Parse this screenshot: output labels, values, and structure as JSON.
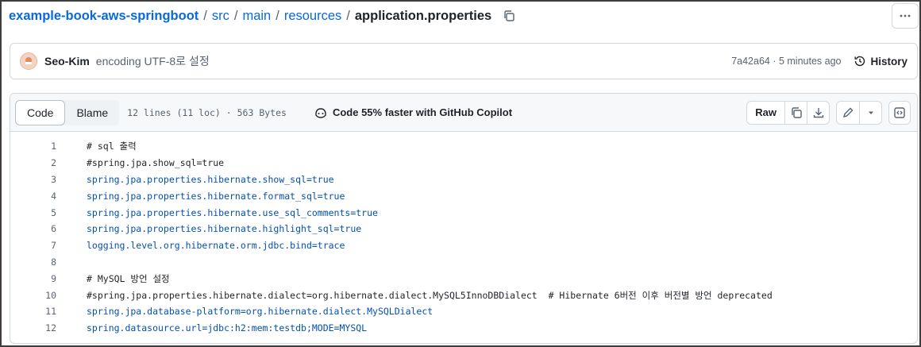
{
  "breadcrumb": {
    "repo": "example-book-aws-springboot",
    "sep": "/",
    "parts": [
      "src",
      "main",
      "resources"
    ],
    "file": "application.properties"
  },
  "commit": {
    "author": "Seo-Kim",
    "message": "encoding UTF-8로 설정",
    "meta": "7a42a64 · 5 minutes ago",
    "history_label": "History"
  },
  "file_header": {
    "tabs": [
      "Code",
      "Blame"
    ],
    "active_tab": "Code",
    "info": "12 lines (11 loc) · 563 Bytes",
    "copilot": "Code 55% faster with GitHub Copilot",
    "raw_label": "Raw"
  },
  "code_lines": [
    {
      "n": "1",
      "text": "# sql 출력",
      "style": "comment"
    },
    {
      "n": "2",
      "text": "#spring.jpa.show_sql=true",
      "style": "comment"
    },
    {
      "n": "3",
      "text": "spring.jpa.properties.hibernate.show_sql=true",
      "style": "key"
    },
    {
      "n": "4",
      "text": "spring.jpa.properties.hibernate.format_sql=true",
      "style": "key"
    },
    {
      "n": "5",
      "text": "spring.jpa.properties.hibernate.use_sql_comments=true",
      "style": "key"
    },
    {
      "n": "6",
      "text": "spring.jpa.properties.hibernate.highlight_sql=true",
      "style": "key"
    },
    {
      "n": "7",
      "text": "logging.level.org.hibernate.orm.jdbc.bind=trace",
      "style": "key"
    },
    {
      "n": "8",
      "text": "",
      "style": "comment"
    },
    {
      "n": "9",
      "text": "# MySQL 방언 설정",
      "style": "comment"
    },
    {
      "n": "10",
      "text": "#spring.jpa.properties.hibernate.dialect=org.hibernate.dialect.MySQL5InnoDBDialect  # Hibernate 6버전 이후 버전별 방언 deprecated",
      "style": "comment"
    },
    {
      "n": "11",
      "text": "spring.jpa.database-platform=org.hibernate.dialect.MySQLDialect",
      "style": "key"
    },
    {
      "n": "12",
      "text": "spring.datasource.url=jdbc:h2:mem:testdb;MODE=MYSQL",
      "style": "key"
    }
  ]
}
